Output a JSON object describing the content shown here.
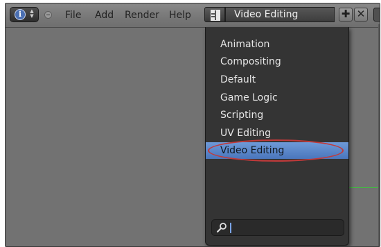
{
  "header": {
    "editor_type_icon": "info-icon",
    "menus": [
      "File",
      "Add",
      "Render",
      "Help"
    ],
    "screen_layout": {
      "icon": "screen-layout-icon",
      "current": "Video Editing",
      "add_icon": "plus-icon",
      "remove_icon": "close-icon"
    }
  },
  "layout_menu": {
    "items": [
      "Animation",
      "Compositing",
      "Default",
      "Game Logic",
      "Scripting",
      "UV Editing",
      "Video Editing"
    ],
    "selected": "Video Editing",
    "search": {
      "icon": "search-icon",
      "value": ""
    }
  },
  "colors": {
    "selected_item": "#5b86c9",
    "highlight_ring": "#c23a3a",
    "menu_background": "#343434"
  }
}
